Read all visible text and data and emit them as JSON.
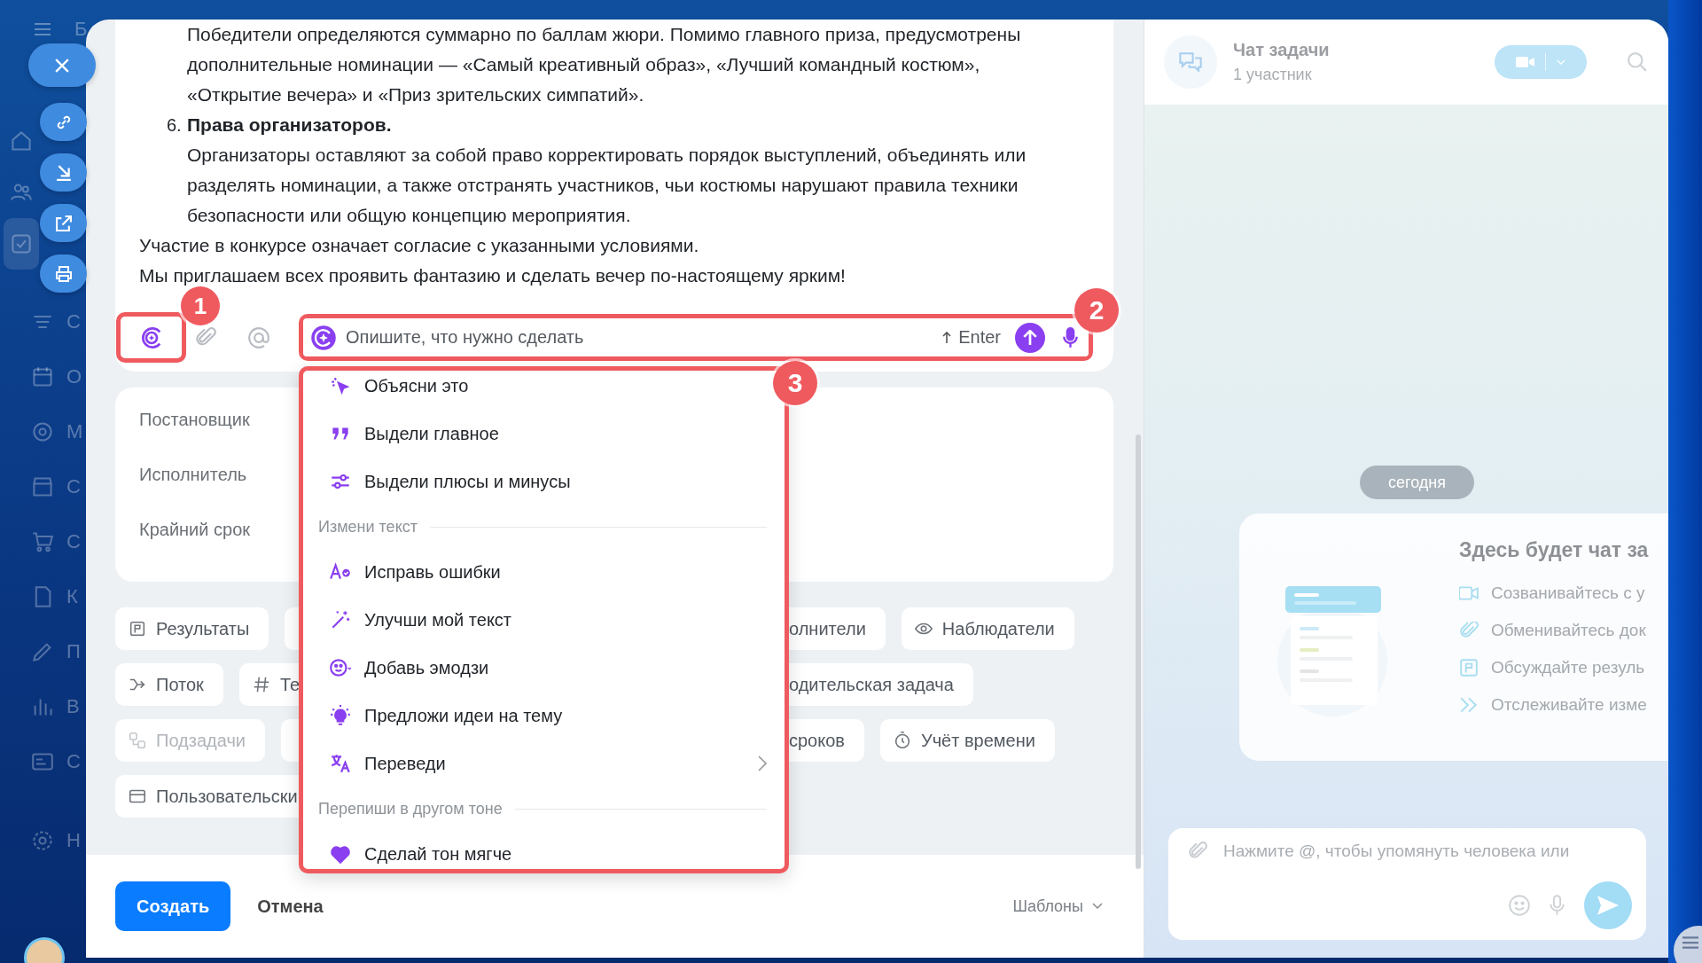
{
  "sidebar": {
    "logo_letter": "Б",
    "items": [
      {
        "selected": false
      },
      {
        "selected": false
      },
      {
        "selected": true
      },
      {
        "label": "С",
        "selected": false
      },
      {
        "label": "О",
        "selected": false
      },
      {
        "label": "М",
        "selected": false
      },
      {
        "label": "С",
        "selected": false
      },
      {
        "label": "С",
        "selected": false
      },
      {
        "label": "К",
        "selected": false
      },
      {
        "label": "П",
        "selected": false
      },
      {
        "label": "В",
        "selected": false
      },
      {
        "label": "С",
        "selected": false
      },
      {
        "label": "Н",
        "selected": false
      }
    ]
  },
  "description": {
    "continuation": "Победители определяются суммарно по баллам жюри. Помимо главного приза, предусмотрены дополнительные номинации — «Самый креативный образ», «Лучший командный костюм», «Открытие вечера» и «Приз зрительских симпатий».",
    "list_item": {
      "number": "6.",
      "title": "Права организаторов.",
      "body": "Организаторы оставляют за собой право корректировать порядок выступлений, объединять или разделять номинации, а также отстранять участников, чьи костюмы нарушают правила техники безопасности или общую концепцию мероприятия."
    },
    "closing": [
      "Участие в конкурсе означает согласие с указанными условиями.",
      "Мы приглашаем всех проявить фантазию и сделать вечер по-настоящему ярким!"
    ]
  },
  "ai_input": {
    "placeholder": "Опишите, что нужно сделать",
    "hint": "Enter"
  },
  "ai_menu": [
    {
      "kind": "explain",
      "label": "Объясни это",
      "submenu": false
    },
    {
      "kind": "quote",
      "label": "Выдели главное",
      "submenu": false
    },
    {
      "kind": "sliders",
      "label": "Выдели плюсы и минусы",
      "submenu": false
    },
    {
      "kind": "section",
      "label": "Измени текст"
    },
    {
      "kind": "spell",
      "label": "Исправь ошибки",
      "submenu": false
    },
    {
      "kind": "wand",
      "label": "Улучши мой текст",
      "submenu": false
    },
    {
      "kind": "emoji",
      "label": "Добавь эмодзи",
      "submenu": false
    },
    {
      "kind": "bulb",
      "label": "Предложи идеи на тему",
      "submenu": false
    },
    {
      "kind": "translate",
      "label": "Переведи",
      "submenu": true
    },
    {
      "kind": "section",
      "label": "Перепиши в другом тоне"
    },
    {
      "kind": "heart",
      "label": "Сделай тон мягче",
      "submenu": false
    }
  ],
  "fields": [
    "Постановщик",
    "Исполнитель",
    "Крайний срок"
  ],
  "chip_rows": [
    {
      "left": [
        {
          "kind": "results",
          "label": "Результаты",
          "disabled": false
        },
        {
          "kind": "cut"
        }
      ],
      "right": [
        {
          "kind": "cut",
          "label": "олнители",
          "disabled": false
        },
        {
          "kind": "observers",
          "label": "Наблюдатели",
          "disabled": false
        }
      ]
    },
    {
      "left": [
        {
          "kind": "flow",
          "label": "Поток",
          "disabled": false
        },
        {
          "kind": "tags",
          "label": "Те",
          "disabled": false
        }
      ],
      "right": [
        {
          "kind": "cut",
          "label": "одительская задача",
          "disabled": false
        }
      ]
    },
    {
      "left": [
        {
          "kind": "subtasks",
          "label": "Подзадачи",
          "disabled": true
        },
        {
          "kind": "cut"
        }
      ],
      "right": [
        {
          "kind": "cut",
          "label": "сроков",
          "disabled": false
        },
        {
          "kind": "time",
          "label": "Учёт времени",
          "disabled": false
        }
      ]
    },
    {
      "left": [
        {
          "kind": "custom",
          "label": "Пользовательски",
          "disabled": false
        }
      ],
      "right": []
    }
  ],
  "footer": {
    "create": "Создать",
    "cancel": "Отмена",
    "templates": "Шаблоны"
  },
  "annotations": [
    {
      "label": "1"
    },
    {
      "label": "2"
    },
    {
      "label": "3"
    }
  ],
  "chat": {
    "title": "Чат задачи",
    "subtitle": "1 участник",
    "date": "сегодня",
    "empty_title": "Здесь будет чат за",
    "features": [
      "Созванивайтесь с у",
      "Обменивайтесь док",
      "Обсуждайте резуль",
      "Отслеживайте изме"
    ],
    "input_placeholder": "Нажмите @, чтобы упомянуть человека или"
  }
}
